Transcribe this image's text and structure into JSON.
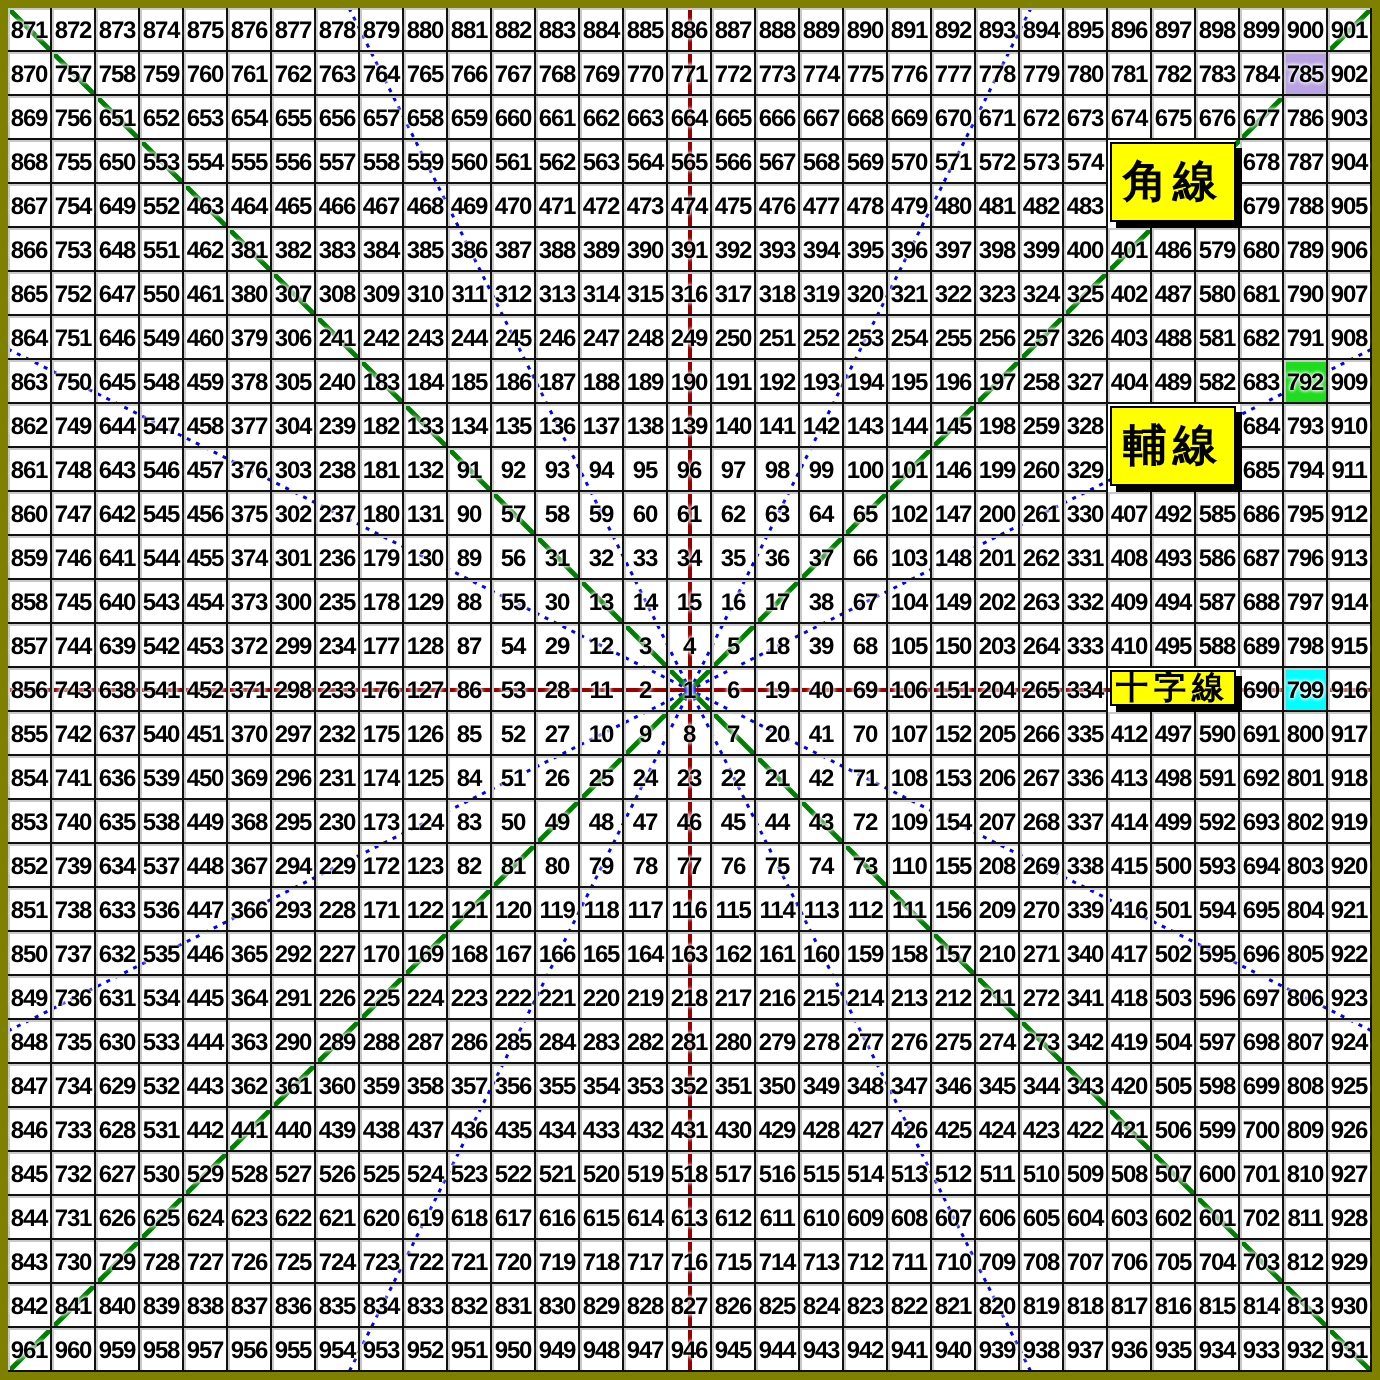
{
  "grid": {
    "rows": [
      [
        "871",
        "872",
        "873",
        "874",
        "875",
        "876",
        "877",
        "878",
        "879",
        "880",
        "881",
        "882",
        "883",
        "884",
        "885",
        "886",
        "887",
        "888",
        "889",
        "890",
        "891",
        "892",
        "893",
        "894",
        "895",
        "896",
        "897",
        "898",
        "899",
        "900",
        "901"
      ],
      [
        "870",
        "757",
        "758",
        "759",
        "760",
        "761",
        "762",
        "763",
        "764",
        "765",
        "766",
        "767",
        "768",
        "769",
        "770",
        "771",
        "772",
        "773",
        "774",
        "775",
        "776",
        "777",
        "778",
        "779",
        "780",
        "781",
        "782",
        "783",
        "784",
        {
          "text": "785",
          "color": "#b9a3e3"
        },
        "902"
      ],
      [
        "869",
        "756",
        "651",
        "652",
        "653",
        "654",
        "655",
        "656",
        "657",
        "658",
        "659",
        "660",
        "661",
        "662",
        "663",
        "664",
        "665",
        "666",
        "667",
        "668",
        "669",
        "670",
        "671",
        "672",
        "673",
        "674",
        "675",
        "676",
        "677",
        "786",
        "903"
      ],
      [
        "868",
        "755",
        "650",
        "553",
        "554",
        "555",
        "556",
        "557",
        "558",
        "559",
        "560",
        "561",
        "562",
        "563",
        "564",
        "565",
        "566",
        "567",
        "568",
        "569",
        "570",
        "571",
        "572",
        "573",
        "574",
        null,
        null,
        null,
        "678",
        "787",
        "904"
      ],
      [
        "867",
        "754",
        "649",
        "552",
        "463",
        "464",
        "465",
        "466",
        "467",
        "468",
        "469",
        "470",
        "471",
        "472",
        "473",
        "474",
        "475",
        "476",
        "477",
        "478",
        "479",
        "480",
        "481",
        "482",
        "483",
        null,
        null,
        null,
        "679",
        "788",
        "905"
      ],
      [
        "866",
        "753",
        "648",
        "551",
        "462",
        "381",
        "382",
        "383",
        "384",
        "385",
        "386",
        "387",
        "388",
        "389",
        "390",
        "391",
        "392",
        "393",
        "394",
        "395",
        "396",
        "397",
        "398",
        "399",
        "400",
        "401",
        "486",
        "579",
        "680",
        "789",
        "906"
      ],
      [
        "865",
        "752",
        "647",
        "550",
        "461",
        "380",
        "307",
        "308",
        "309",
        "310",
        "311",
        "312",
        "313",
        "314",
        "315",
        "316",
        "317",
        "318",
        "319",
        "320",
        "321",
        "322",
        "323",
        "324",
        "325",
        "402",
        "487",
        "580",
        "681",
        "790",
        "907"
      ],
      [
        "864",
        "751",
        "646",
        "549",
        "460",
        "379",
        "306",
        "241",
        "242",
        "243",
        "244",
        "245",
        "246",
        "247",
        "248",
        "249",
        "250",
        "251",
        "252",
        "253",
        "254",
        "255",
        "256",
        "257",
        "326",
        "403",
        "488",
        "581",
        "682",
        "791",
        "908"
      ],
      [
        "863",
        "750",
        "645",
        "548",
        "459",
        "378",
        "305",
        "240",
        "183",
        "184",
        "185",
        "186",
        "187",
        "188",
        "189",
        "190",
        "191",
        "192",
        "193",
        "194",
        "195",
        "196",
        "197",
        "258",
        "327",
        "404",
        "489",
        "582",
        "683",
        {
          "text": "792",
          "color": "#1edc1e"
        },
        "909"
      ],
      [
        "862",
        "749",
        "644",
        "547",
        "458",
        "377",
        "304",
        "239",
        "182",
        "133",
        "134",
        "135",
        "136",
        "137",
        "138",
        "139",
        "140",
        "141",
        "142",
        "143",
        "144",
        "145",
        "198",
        "259",
        "328",
        null,
        null,
        null,
        "684",
        "793",
        "910"
      ],
      [
        "861",
        "748",
        "643",
        "546",
        "457",
        "376",
        "303",
        "238",
        "181",
        "132",
        "91",
        "92",
        "93",
        "94",
        "95",
        "96",
        "97",
        "98",
        "99",
        "100",
        "101",
        "146",
        "199",
        "260",
        "329",
        null,
        null,
        null,
        "685",
        "794",
        "911"
      ],
      [
        "860",
        "747",
        "642",
        "545",
        "456",
        "375",
        "302",
        "237",
        "180",
        "131",
        "90",
        "57",
        "58",
        "59",
        "60",
        "61",
        "62",
        "63",
        "64",
        "65",
        "102",
        "147",
        "200",
        "261",
        "330",
        "407",
        "492",
        "585",
        "686",
        "795",
        "912"
      ],
      [
        "859",
        "746",
        "641",
        "544",
        "455",
        "374",
        "301",
        "236",
        "179",
        "130",
        "89",
        "56",
        "31",
        "32",
        "33",
        "34",
        "35",
        "36",
        "37",
        "66",
        "103",
        "148",
        "201",
        "262",
        "331",
        "408",
        "493",
        "586",
        "687",
        "796",
        "913"
      ],
      [
        "858",
        "745",
        "640",
        "543",
        "454",
        "373",
        "300",
        "235",
        "178",
        "129",
        "88",
        "55",
        "30",
        "13",
        "14",
        "15",
        "16",
        "17",
        "38",
        "67",
        "104",
        "149",
        "202",
        "263",
        "332",
        "409",
        "494",
        "587",
        "688",
        "797",
        "914"
      ],
      [
        "857",
        "744",
        "639",
        "542",
        "453",
        "372",
        "299",
        "234",
        "177",
        "128",
        "87",
        "54",
        "29",
        "12",
        "3",
        "4",
        "5",
        "18",
        "39",
        "68",
        "105",
        "150",
        "203",
        "264",
        "333",
        "410",
        "495",
        "588",
        "689",
        "798",
        "915"
      ],
      [
        "856",
        "743",
        "638",
        "541",
        "452",
        "371",
        "298",
        "233",
        "176",
        "127",
        "86",
        "53",
        "28",
        "11",
        "2",
        "1",
        "6",
        "19",
        "40",
        "69",
        "106",
        "151",
        "204",
        "265",
        "334",
        null,
        null,
        null,
        "690",
        {
          "text": "799",
          "color": "#00ffff"
        },
        "916"
      ],
      [
        "855",
        "742",
        "637",
        "540",
        "451",
        "370",
        "297",
        "232",
        "175",
        "126",
        "85",
        "52",
        "27",
        "10",
        "9",
        "8",
        "7",
        "20",
        "41",
        "70",
        "107",
        "152",
        "205",
        "266",
        "335",
        "412",
        "497",
        "590",
        "691",
        "800",
        "917"
      ],
      [
        "854",
        "741",
        "636",
        "539",
        "450",
        "369",
        "296",
        "231",
        "174",
        "125",
        "84",
        "51",
        "26",
        "25",
        "24",
        "23",
        "22",
        "21",
        "42",
        "71",
        "108",
        "153",
        "206",
        "267",
        "336",
        "413",
        "498",
        "591",
        "692",
        "801",
        "918"
      ],
      [
        "853",
        "740",
        "635",
        "538",
        "449",
        "368",
        "295",
        "230",
        "173",
        "124",
        "83",
        "50",
        "49",
        "48",
        "47",
        "46",
        "45",
        "44",
        "43",
        "72",
        "109",
        "154",
        "207",
        "268",
        "337",
        "414",
        "499",
        "592",
        "693",
        "802",
        "919"
      ],
      [
        "852",
        "739",
        "634",
        "537",
        "448",
        "367",
        "294",
        "229",
        "172",
        "123",
        "82",
        "81",
        "80",
        "79",
        "78",
        "77",
        "76",
        "75",
        "74",
        "73",
        "110",
        "155",
        "208",
        "269",
        "338",
        "415",
        "500",
        "593",
        "694",
        "803",
        "920"
      ],
      [
        "851",
        "738",
        "633",
        "536",
        "447",
        "366",
        "293",
        "228",
        "171",
        "122",
        "121",
        "120",
        "119",
        "118",
        "117",
        "116",
        "115",
        "114",
        "113",
        "112",
        "111",
        "156",
        "209",
        "270",
        "339",
        "416",
        "501",
        "594",
        "695",
        "804",
        "921"
      ],
      [
        "850",
        "737",
        "632",
        "535",
        "446",
        "365",
        "292",
        "227",
        "170",
        "169",
        "168",
        "167",
        "166",
        "165",
        "164",
        "163",
        "162",
        "161",
        "160",
        "159",
        "158",
        "157",
        "210",
        "271",
        "340",
        "417",
        "502",
        "595",
        "696",
        "805",
        "922"
      ],
      [
        "849",
        "736",
        "631",
        "534",
        "445",
        "364",
        "291",
        "226",
        "225",
        "224",
        "223",
        "222",
        "221",
        "220",
        "219",
        "218",
        "217",
        "216",
        "215",
        "214",
        "213",
        "212",
        "211",
        "272",
        "341",
        "418",
        "503",
        "596",
        "697",
        "806",
        "923"
      ],
      [
        "848",
        "735",
        "630",
        "533",
        "444",
        "363",
        "290",
        "289",
        "288",
        "287",
        "286",
        "285",
        "284",
        "283",
        "282",
        "281",
        "280",
        "279",
        "278",
        "277",
        "276",
        "275",
        "274",
        "273",
        "342",
        "419",
        "504",
        "597",
        "698",
        "807",
        "924"
      ],
      [
        "847",
        "734",
        "629",
        "532",
        "443",
        "362",
        "361",
        "360",
        "359",
        "358",
        "357",
        "356",
        "355",
        "354",
        "353",
        "352",
        "351",
        "350",
        "349",
        "348",
        "347",
        "346",
        "345",
        "344",
        "343",
        "420",
        "505",
        "598",
        "699",
        "808",
        "925"
      ],
      [
        "846",
        "733",
        "628",
        "531",
        "442",
        "441",
        "440",
        "439",
        "438",
        "437",
        "436",
        "435",
        "434",
        "433",
        "432",
        "431",
        "430",
        "429",
        "428",
        "427",
        "426",
        "425",
        "424",
        "423",
        "422",
        "421",
        "506",
        "599",
        "700",
        "809",
        "926"
      ],
      [
        "845",
        "732",
        "627",
        "530",
        "529",
        "528",
        "527",
        "526",
        "525",
        "524",
        "523",
        "522",
        "521",
        "520",
        "519",
        "518",
        "517",
        "516",
        "515",
        "514",
        "513",
        "512",
        "511",
        "510",
        "509",
        "508",
        "507",
        "600",
        "701",
        "810",
        "927"
      ],
      [
        "844",
        "731",
        "626",
        "625",
        "624",
        "623",
        "622",
        "621",
        "620",
        "619",
        "618",
        "617",
        "616",
        "615",
        "614",
        "613",
        "612",
        "611",
        "610",
        "609",
        "608",
        "607",
        "606",
        "605",
        "604",
        "603",
        "602",
        "601",
        "702",
        "811",
        "928"
      ],
      [
        "843",
        "730",
        "729",
        "728",
        "727",
        "726",
        "725",
        "724",
        "723",
        "722",
        "721",
        "720",
        "719",
        "718",
        "717",
        "716",
        "715",
        "714",
        "713",
        "712",
        "711",
        "710",
        "709",
        "708",
        "707",
        "706",
        "705",
        "704",
        "703",
        "812",
        "929"
      ],
      [
        "842",
        "841",
        "840",
        "839",
        "838",
        "837",
        "836",
        "835",
        "834",
        "833",
        "832",
        "831",
        "830",
        "829",
        "828",
        "827",
        "826",
        "825",
        "824",
        "823",
        "822",
        "821",
        "820",
        "819",
        "818",
        "817",
        "816",
        "815",
        "814",
        "813",
        "930"
      ],
      [
        "961",
        "960",
        "959",
        "958",
        "957",
        "956",
        "955",
        "954",
        "953",
        "952",
        "951",
        "950",
        "949",
        "948",
        "947",
        "946",
        "945",
        "944",
        "943",
        "942",
        "941",
        "940",
        "939",
        "938",
        "937",
        "936",
        "935",
        "934",
        "933",
        "932",
        "931"
      ]
    ]
  },
  "labels": [
    "角線",
    "輔線",
    "十字線"
  ]
}
